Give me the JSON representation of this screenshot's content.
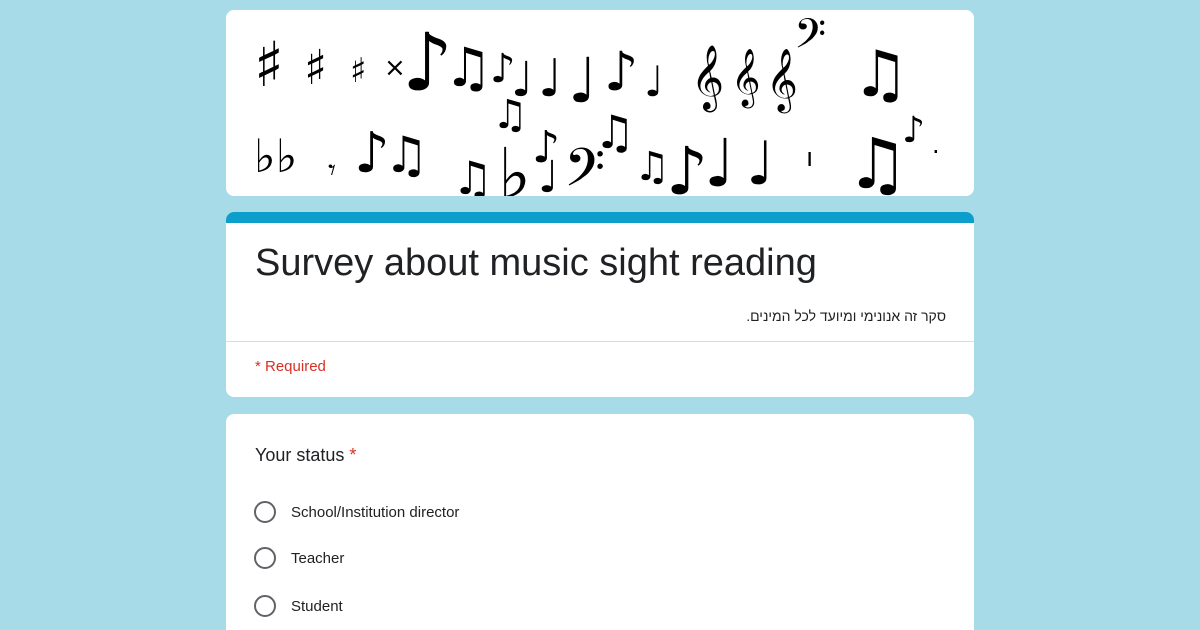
{
  "form": {
    "title": "Survey about music sight reading",
    "description": "סקר זה אנונימי ומיועד לכל המינים.",
    "required_note": "* Required",
    "accent_color": "#0c9fcb",
    "background_color": "#a8dbe8"
  },
  "banner": {
    "image": "music-notes-banner",
    "glyphs": [
      "♯",
      "♭",
      "♪",
      "♫",
      "𝄞",
      "𝄢",
      "𝄾"
    ]
  },
  "question": {
    "title": "Your status",
    "required_mark": "*",
    "options": [
      {
        "label": "School/Institution director"
      },
      {
        "label": "Teacher"
      },
      {
        "label": "Student"
      }
    ]
  }
}
